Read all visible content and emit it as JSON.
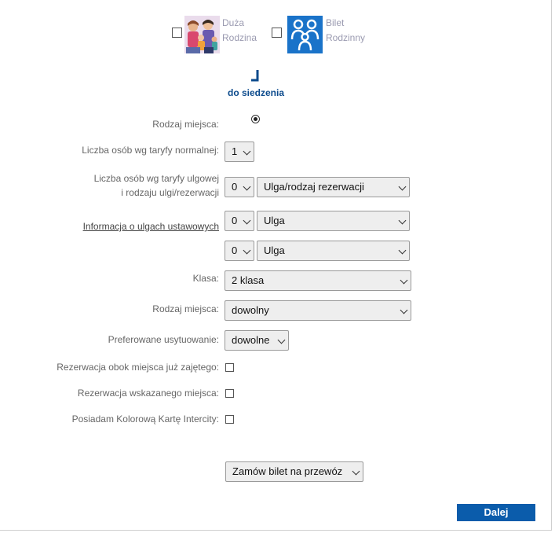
{
  "offers": [
    {
      "label_line1": "Duża",
      "label_line2": "Rodzina"
    },
    {
      "label_line1": "Bilet",
      "label_line2": "Rodzinny"
    }
  ],
  "seat_type": {
    "caption": "do siedzenia",
    "label": "Rodzaj miejsca:"
  },
  "form": {
    "normal_count_label": "Liczba osób wg taryfy normalnej:",
    "normal_count_value": "1",
    "reduced_label_line1": "Liczba osób wg taryfy ulgowej",
    "reduced_label_line2": "i rodzaju ulgi/rezerwacji",
    "reduced_rows": [
      {
        "count": "0",
        "discount": "Ulga/rodzaj rezerwacji"
      },
      {
        "count": "0",
        "discount": "Ulga"
      },
      {
        "count": "0",
        "discount": "Ulga"
      }
    ],
    "discount_info_link": "Informacja o ulgach ustawowych",
    "class_label": "Klasa:",
    "class_value": "2 klasa",
    "place_label": "Rodzaj miejsca:",
    "place_value": "dowolny",
    "position_label": "Preferowane usytuowanie:",
    "position_value": "dowolne",
    "next_to_taken_label": "Rezerwacja obok miejsca już zajętego:",
    "indicated_seat_label": "Rezerwacja wskazanego miejsca:",
    "color_card_label": "Posiadam Kolorową Kartę Intercity:"
  },
  "transport": {
    "value": "Zamów bilet na przewóz"
  },
  "actions": {
    "next_label": "Dalej"
  },
  "colors": {
    "accent": "#0b5cab",
    "offer_blue": "#1a73c9"
  }
}
